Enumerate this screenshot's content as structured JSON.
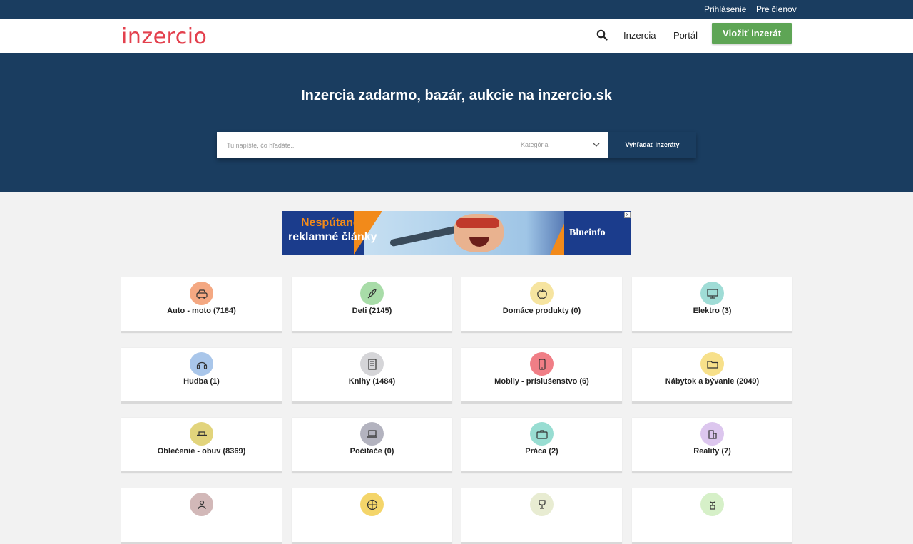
{
  "topbar": {
    "login": "Prihlásenie",
    "members": "Pre členov"
  },
  "header": {
    "logo": "inzercio",
    "nav": {
      "inzercia": "Inzercia",
      "portal": "Portál"
    },
    "post_button": "Vložiť inzerát"
  },
  "hero": {
    "title": "Inzercia zadarmo, bazár, aukcie na inzercio.sk",
    "search_placeholder": "Tu napíšte, čo hľadáte..",
    "category_placeholder": "Kategória",
    "search_button": "Vyhľadať inzeráty"
  },
  "ad": {
    "line1": "Nespútané",
    "line2": "reklamné články",
    "brand": "Blueinfo",
    "close": "x"
  },
  "colors": {
    "primary": "#1a3d60",
    "accent_green": "#5ea555",
    "logo_red": "#e3404d"
  },
  "categories": [
    {
      "label": "Auto - moto (7184)",
      "icon": "car-icon",
      "color": "#f4a882"
    },
    {
      "label": "Deti (2145)",
      "icon": "rocket-icon",
      "color": "#a8dca8"
    },
    {
      "label": "Domáce produkty (0)",
      "icon": "apple-icon",
      "color": "#f6e4a0"
    },
    {
      "label": "Elektro (3)",
      "icon": "monitor-icon",
      "color": "#9fdcd6"
    },
    {
      "label": "Hudba (1)",
      "icon": "headphones-icon",
      "color": "#a9c6ea"
    },
    {
      "label": "Knihy (1484)",
      "icon": "book-icon",
      "color": "#d5d5d8"
    },
    {
      "label": "Mobily - príslušenstvo (6)",
      "icon": "phone-icon",
      "color": "#f07e86"
    },
    {
      "label": "Nábytok a bývanie (2049)",
      "icon": "folder-icon",
      "color": "#f7e08a"
    },
    {
      "label": "Oblečenie - obuv (8369)",
      "icon": "hat-icon",
      "color": "#e2d47c"
    },
    {
      "label": "Počítače (0)",
      "icon": "laptop-icon",
      "color": "#b3b3bf"
    },
    {
      "label": "Práca (2)",
      "icon": "briefcase-icon",
      "color": "#98ddd2"
    },
    {
      "label": "Reality (7)",
      "icon": "building-icon",
      "color": "#dcc6ee"
    },
    {
      "label": "",
      "icon": "people-icon",
      "color": "#d2b8b8"
    },
    {
      "label": "",
      "icon": "basketball-icon",
      "color": "#f4d56a"
    },
    {
      "label": "",
      "icon": "trophy-icon",
      "color": "#e8ecd2"
    },
    {
      "label": "",
      "icon": "plant-icon",
      "color": "#d6f0c8"
    }
  ]
}
